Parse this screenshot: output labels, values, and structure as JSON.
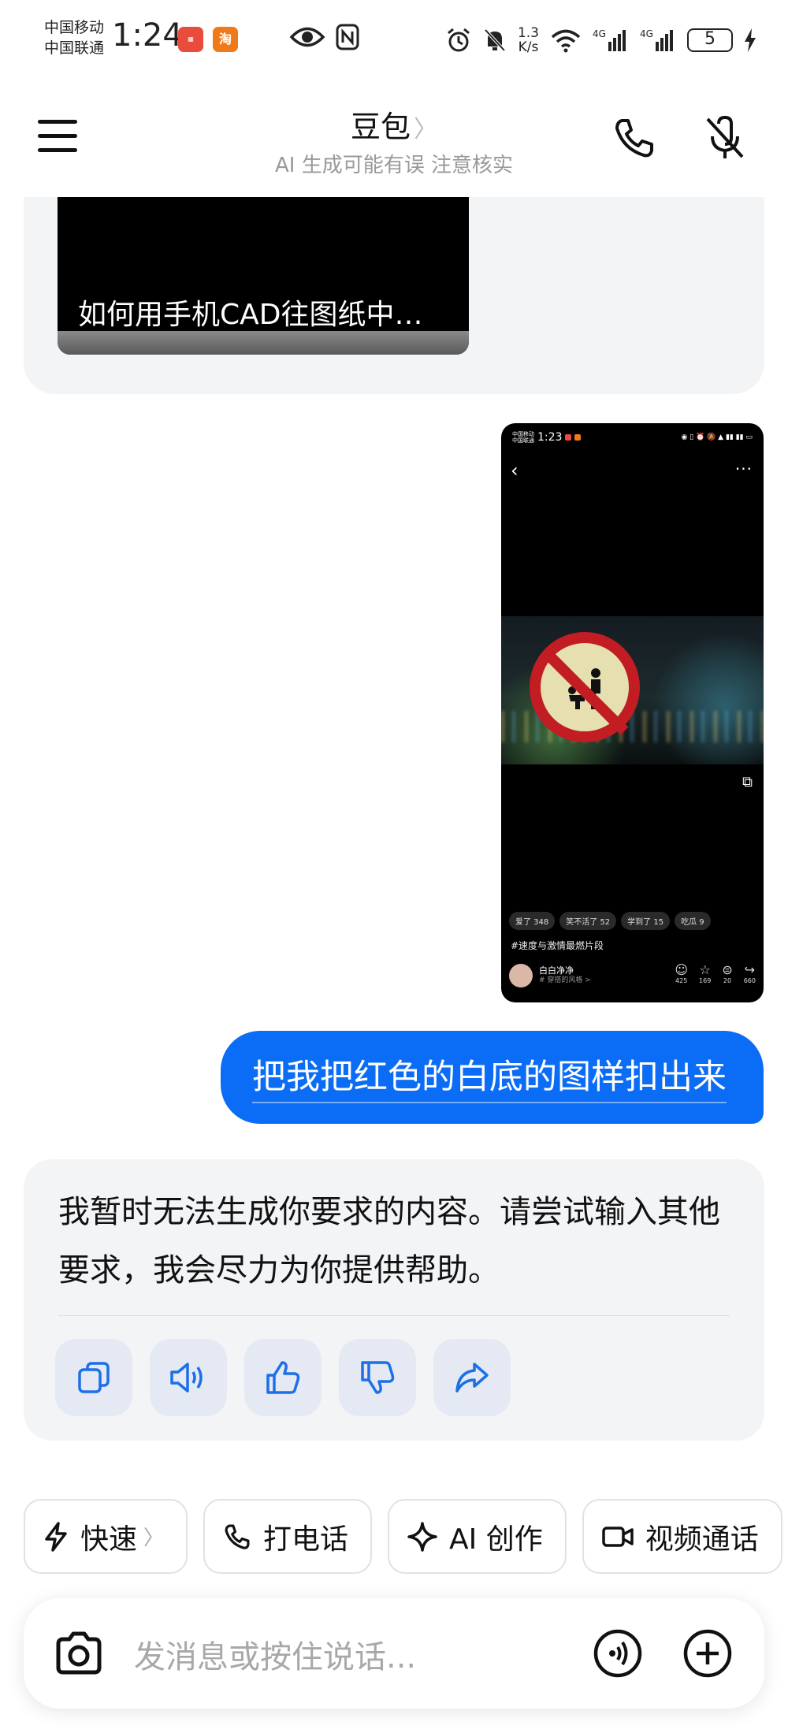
{
  "status_bar": {
    "carrier1": "中国移动",
    "carrier2": "中国联通",
    "time": "1:24",
    "app_badge_taobao": "淘",
    "net_speed_top": "1.3",
    "net_speed_bottom": "K/s",
    "battery": "5",
    "icons": [
      "huawei-store-icon",
      "taobao-icon",
      "eye-icon",
      "nfc-icon",
      "alarm-icon",
      "bell-mute-icon",
      "wifi-icon",
      "signal-4g-icon",
      "signal-4g-icon",
      "battery-icon",
      "charging-icon"
    ]
  },
  "header": {
    "title": "豆包",
    "title_chevron": "〉",
    "subtitle": "AI 生成可能有误 注意核实",
    "icons": [
      "menu-icon",
      "phone-icon",
      "mic-mute-icon"
    ]
  },
  "chat": {
    "video_card_title": "如何用手机CAD往图纸中…",
    "screenshot": {
      "time": "1:23",
      "carrier1": "中国移动",
      "carrier2": "中国联通",
      "chips": [
        "爱了 348",
        "笑不活了 52",
        "学到了 15",
        "吃瓜 9"
      ],
      "tag": "#速度与激情最燃片段",
      "username": "白白净净",
      "user_sub": "# 穿搭的风格 >",
      "stats": [
        "425",
        "169",
        "20",
        "660"
      ]
    },
    "user_message": "把我把红色的白底的图样扣出来",
    "ai_message": "我暂时无法生成你要求的内容。请尝试输入其他要求，我会尽力为你提供帮助。",
    "ai_actions": [
      "copy-icon",
      "speaker-icon",
      "thumbs-up-icon",
      "thumbs-down-icon",
      "share-icon"
    ]
  },
  "quick_actions": [
    {
      "label": "快速",
      "icon": "lightning-icon",
      "chevron": "〉"
    },
    {
      "label": "打电话",
      "icon": "phone-icon"
    },
    {
      "label": "AI 创作",
      "icon": "sparkle-icon"
    },
    {
      "label": "视频通话",
      "icon": "video-icon"
    }
  ],
  "input": {
    "placeholder": "发消息或按住说话...",
    "icons": [
      "camera-icon",
      "voice-icon",
      "plus-icon"
    ]
  },
  "colors": {
    "accent": "#0b6cf5",
    "bubble_bg": "#f3f4f6",
    "sign_red": "#c21d22"
  }
}
